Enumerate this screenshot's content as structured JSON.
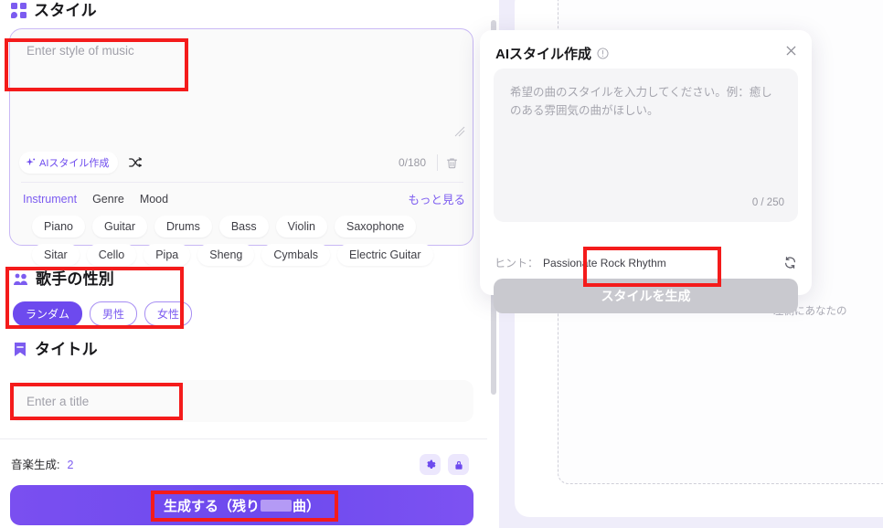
{
  "style_section": {
    "heading": "スタイル",
    "heading_icon": "style-grid-icon",
    "textarea_placeholder": "Enter style of music",
    "textarea_value": "",
    "ai_style_button": "AIスタイル作成",
    "ai_style_icon": "sparkle-icon",
    "shuffle_icon": "shuffle-icon",
    "char_count": "0/180",
    "trash_icon": "trash-icon",
    "resize_icon": "resize-grip-icon",
    "tabs": [
      {
        "label": "Instrument",
        "active": true
      },
      {
        "label": "Genre",
        "active": false
      },
      {
        "label": "Mood",
        "active": false
      }
    ],
    "more_link": "もっと見る",
    "chips": [
      "Piano",
      "Guitar",
      "Drums",
      "Bass",
      "Violin",
      "Saxophone",
      "Sitar",
      "Cello",
      "Pipa",
      "Sheng",
      "Cymbals",
      "Electric Guitar"
    ]
  },
  "gender_section": {
    "heading": "歌手の性別",
    "heading_icon": "gender-people-icon",
    "options": [
      {
        "label": "ランダム",
        "selected": true
      },
      {
        "label": "男性",
        "selected": false
      },
      {
        "label": "女性",
        "selected": false
      }
    ]
  },
  "title_section": {
    "heading": "タイトル",
    "heading_icon": "bookmark-icon",
    "input_placeholder": "Enter a title",
    "input_value": ""
  },
  "footer": {
    "credit_label": "音楽生成:",
    "credit_value": "2",
    "settings_icon": "gear-icon",
    "lock_icon": "lock-icon",
    "generate_prefix": "生成する（残り",
    "generate_suffix": "曲）",
    "generate_redacted": true
  },
  "right_panel": {
    "hint_text": "左側にあなたの"
  },
  "modal": {
    "title": "AIスタイル作成",
    "info_icon": "info-circle-icon",
    "close_icon": "close-icon",
    "textarea_placeholder": "希望の曲のスタイルを入力してください。例：癒しのある雰囲気の曲がほしい。",
    "textarea_value": "",
    "char_count": "0 / 250",
    "hint_label": "ヒント：",
    "hint_value": "Passionate Rock Rhythm",
    "refresh_icon": "refresh-icon",
    "generate_button": "スタイルを生成"
  },
  "colors": {
    "accent_purple": "#6d4aee",
    "accent_purple_light": "#7c5cf0",
    "annotation_red": "#f41b1b",
    "panel_bg": "#efedfa",
    "field_bg": "#fafafa",
    "modal_button_disabled": "#c9c9cf"
  }
}
